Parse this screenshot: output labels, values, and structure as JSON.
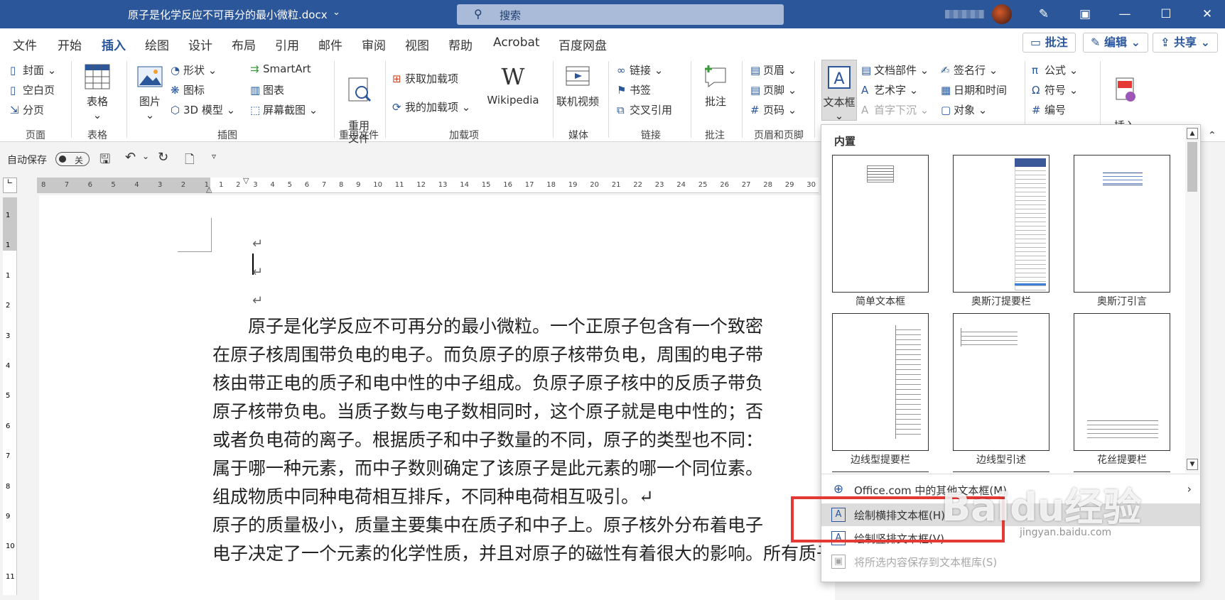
{
  "titlebar": {
    "doc_title": "原子是化学反应不可再分的最小微粒.docx",
    "search_placeholder": "搜索",
    "icons": [
      "search-icon",
      "pen-icon",
      "ribbon-display-icon",
      "minimize-icon",
      "maximize-icon",
      "close-icon"
    ]
  },
  "tabs": [
    "文件",
    "开始",
    "插入",
    "绘图",
    "设计",
    "布局",
    "引用",
    "邮件",
    "审阅",
    "视图",
    "帮助",
    "Acrobat",
    "百度网盘"
  ],
  "active_tab": "插入",
  "actions": {
    "comments": "批注",
    "edit": "编辑",
    "share": "共享"
  },
  "ribbon": {
    "pages": {
      "items": [
        "封面",
        "空白页",
        "分页"
      ],
      "label": "页面"
    },
    "tables": {
      "item": "表格",
      "label": "表格"
    },
    "illustrations": {
      "picture": "图片",
      "items": [
        "形状",
        "图标",
        "3D 模型"
      ],
      "items2": [
        "SmartArt",
        "图表",
        "屏幕截图"
      ],
      "label": "插图"
    },
    "reuse": {
      "item": "重用\n文件",
      "label": "重用文件"
    },
    "addins": {
      "items": [
        "获取加载项",
        "我的加载项"
      ],
      "wiki": "Wikipedia",
      "label": "加载项"
    },
    "media": {
      "item": "联机视频",
      "label": "媒体"
    },
    "links": {
      "items": [
        "链接",
        "书签",
        "交叉引用"
      ],
      "label": "链接"
    },
    "comments": {
      "item": "批注",
      "label": "批注"
    },
    "header_footer": {
      "items": [
        "页眉",
        "页脚",
        "页码"
      ],
      "label": "页眉和页脚"
    },
    "text": {
      "textbox": "文本框",
      "items": [
        "文档部件",
        "艺术字",
        "首字下沉"
      ],
      "items2": [
        "签名行",
        "日期和时间",
        "对象"
      ]
    },
    "symbols": {
      "items": [
        "公式",
        "符号",
        "编号"
      ]
    },
    "insert_media": "插入\n媒体"
  },
  "qat": {
    "autosave": "自动保存",
    "toggle": "关"
  },
  "ruler_left": [
    "8",
    "7",
    "6",
    "5",
    "4",
    "3",
    "2",
    "1"
  ],
  "ruler_right": [
    "1",
    "2",
    "3",
    "4",
    "5",
    "6",
    "7",
    "8",
    "9",
    "10",
    "11",
    "12",
    "13",
    "14",
    "15",
    "16",
    "17",
    "18",
    "19",
    "20",
    "21",
    "22",
    "23",
    "24",
    "25",
    "26",
    "27",
    "28",
    "29",
    "30"
  ],
  "ruler_vertical": [
    "1",
    "1",
    "1",
    "2",
    "3",
    "4",
    "5",
    "6",
    "7",
    "8",
    "9",
    "10",
    "11"
  ],
  "document": {
    "lines": [
      "　　原子是化学反应不可再分的最小微粒。一个正原子包含有一个致密",
      "在原子核周围带负电的电子。而负原子的原子核带负电，周围的电子带",
      "核由带正电的质子和电中性的中子组成。负原子原子核中的反质子带负",
      "原子核带负电。当质子数与电子数相同时，这个原子就是电中性的；否",
      "或者负电荷的离子。根据质子和中子数量的不同，原子的类型也不同：",
      "属于哪一种元素，而中子数则确定了该原子是此元素的哪一个同位素。",
      "组成物质中同种电荷相互排斥，不同种电荷相互吸引。↵",
      "原子的质量极小，质量主要集中在质子和中子上。原子核外分布着电子",
      "电子决定了一个元素的化学性质，并且对原子的磁性有着很大的影响。所有质子数相同的原"
    ],
    "para_mark": "↵"
  },
  "dropdown": {
    "header": "内置",
    "gallery": [
      "简单文本框",
      "奥斯汀提要栏",
      "奥斯汀引言",
      "边线型提要栏",
      "边线型引述",
      "花丝提要栏"
    ],
    "menu": [
      {
        "label": "Office.com 中的其他文本框(M)",
        "icon": "globe-icon"
      },
      {
        "label": "绘制横排文本框(H)",
        "icon": "textbox-horizontal-icon"
      },
      {
        "label": "绘制竖排文本框(V)",
        "icon": "textbox-vertical-icon"
      },
      {
        "label": "将所选内容保存到文本框库(S)",
        "icon": "save-icon"
      }
    ]
  },
  "watermark": {
    "brand": "Baidu经验",
    "url": "jingyan.baidu.com"
  },
  "colors": {
    "accent": "#2b579a",
    "highlight": "#e53935"
  }
}
